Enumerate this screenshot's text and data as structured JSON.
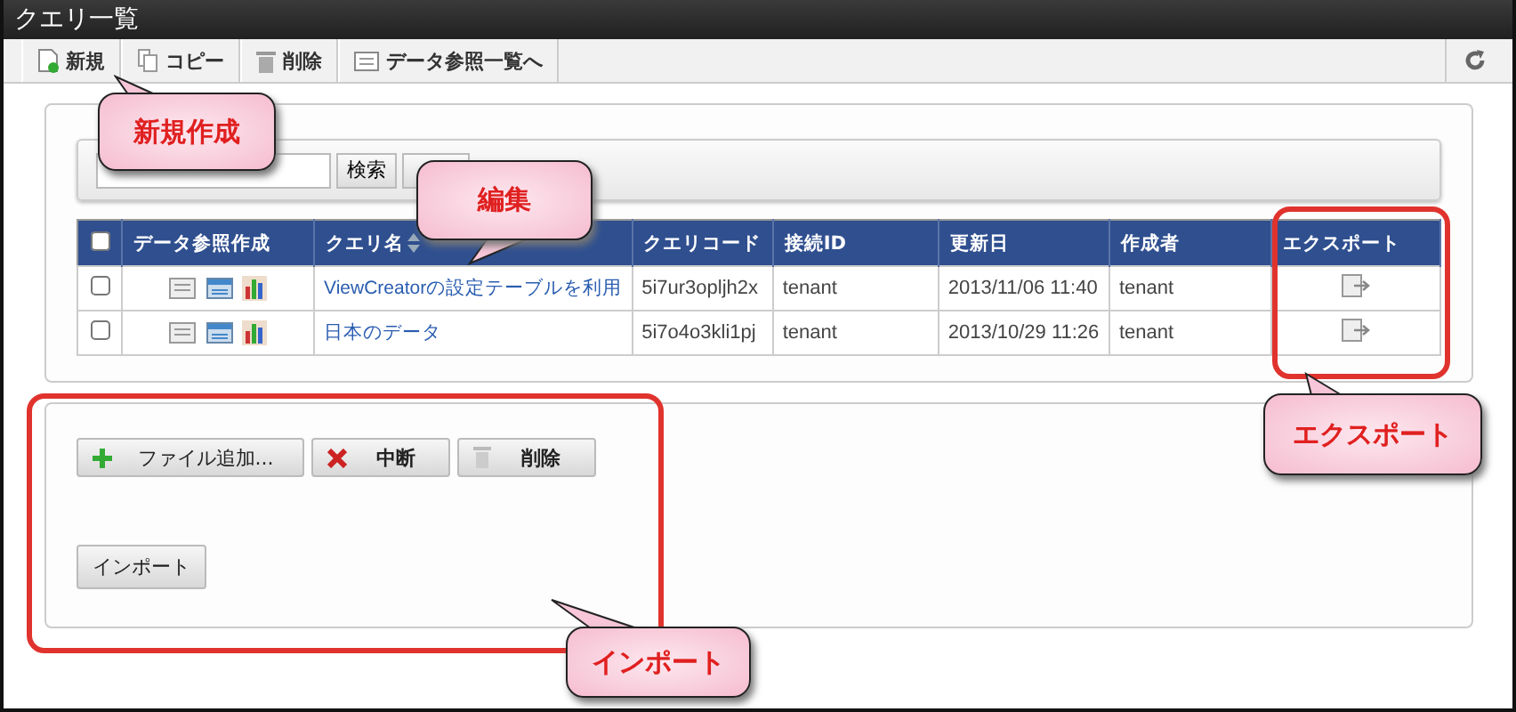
{
  "window": {
    "title": "クエリ一覧"
  },
  "toolbar": [
    {
      "label": "新規",
      "kind": "new"
    },
    {
      "label": "コピー",
      "kind": "copy"
    },
    {
      "label": "削除",
      "kind": "delete"
    },
    {
      "label": "データ参照一覧へ",
      "kind": "list"
    }
  ],
  "search": {
    "button": "検索"
  },
  "table": {
    "select_all": {
      "checked": false
    },
    "columns": [
      {
        "label": "データ参照作成",
        "sortable": false
      },
      {
        "label": "クエリ名",
        "sortable": true
      },
      {
        "label": "クエリコード",
        "sortable": false
      },
      {
        "label": "接続ID",
        "sortable": false
      },
      {
        "label": "更新日",
        "sortable": false
      },
      {
        "label": "作成者",
        "sortable": false
      },
      {
        "label": "エクスポート",
        "sortable": false
      }
    ],
    "rows": [
      {
        "checked": false,
        "name": "ViewCreatorの設定テーブルを利用",
        "code": "5i7ur3opljh2x",
        "connection": "tenant",
        "updated": "2013/11/06 11:40",
        "creator": "tenant"
      },
      {
        "checked": false,
        "name": "日本のデータ",
        "code": "5i7o4o3kli1pj",
        "connection": "tenant",
        "updated": "2013/10/29 11:26",
        "creator": "tenant"
      }
    ]
  },
  "upload": {
    "buttons": [
      {
        "label": "ファイル追加...",
        "kind": "add"
      },
      {
        "label": "中断",
        "kind": "cancel"
      },
      {
        "label": "削除",
        "kind": "delete"
      }
    ],
    "import_button": "インポート"
  },
  "callouts": [
    {
      "text": "新規作成",
      "kind": "new"
    },
    {
      "text": "編集",
      "kind": "edit"
    },
    {
      "text": "エクスポート",
      "kind": "export"
    },
    {
      "text": "インポート",
      "kind": "import"
    }
  ]
}
